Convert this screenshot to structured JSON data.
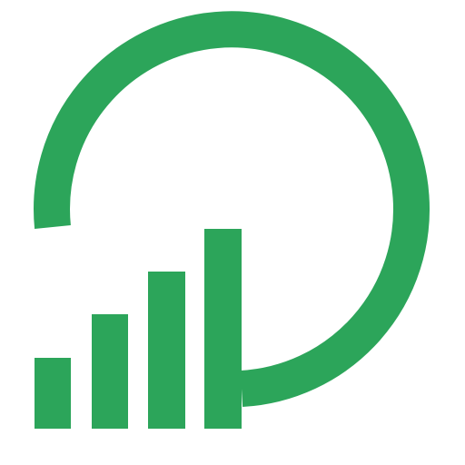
{
  "brand": {
    "logo_name": "growth-bars-arc-logo",
    "color": "#2ca55a",
    "background": "#ffffff"
  },
  "bars": {
    "count": 4,
    "levels_relative": [
      0.24,
      0.48,
      0.72,
      1.0
    ]
  }
}
